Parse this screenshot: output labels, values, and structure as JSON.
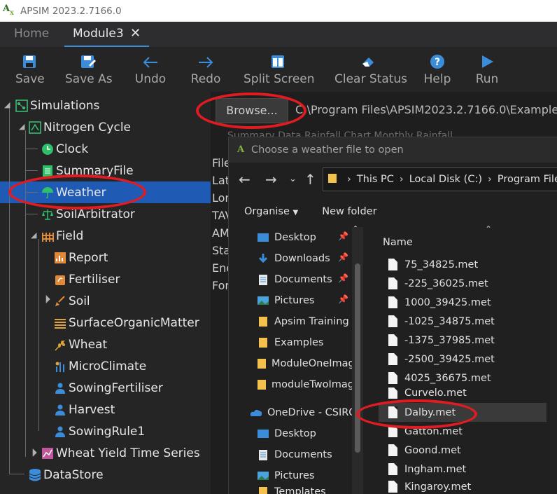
{
  "window": {
    "title": "APSIM 2023.2.7166.0",
    "logo_text": "Ax"
  },
  "tabs": [
    {
      "label": "Home"
    },
    {
      "label": "Module3",
      "close": "✕"
    }
  ],
  "toolbar": {
    "buttons": [
      {
        "label": "Save",
        "icon": "save-icon"
      },
      {
        "label": "Save As",
        "icon": "save-as-icon"
      },
      {
        "label": "Undo",
        "icon": "undo-icon"
      },
      {
        "label": "Redo",
        "icon": "redo-icon"
      },
      {
        "label": "Split Screen",
        "icon": "split-screen-icon"
      },
      {
        "label": "Clear Status",
        "icon": "eraser-icon"
      },
      {
        "label": "Help",
        "icon": "help-icon"
      },
      {
        "label": "Run",
        "icon": "run-icon"
      }
    ]
  },
  "tree": {
    "nodes": [
      {
        "label": "Simulations",
        "icon": "simulations-icon"
      },
      {
        "label": "Nitrogen Cycle",
        "icon": "simulation-icon"
      },
      {
        "label": "Clock",
        "icon": "clock-icon"
      },
      {
        "label": "SummaryFile",
        "icon": "summary-icon"
      },
      {
        "label": "Weather",
        "icon": "weather-icon",
        "selected": true
      },
      {
        "label": "SoilArbitrator",
        "icon": "scales-icon"
      },
      {
        "label": "Field",
        "icon": "field-fence-icon"
      },
      {
        "label": "Report",
        "icon": "report-icon"
      },
      {
        "label": "Fertiliser",
        "icon": "fertiliser-icon"
      },
      {
        "label": "Soil",
        "icon": "shovel-icon"
      },
      {
        "label": "SurfaceOrganicMatter",
        "icon": "surface-om-icon"
      },
      {
        "label": "Wheat",
        "icon": "wheat-icon"
      },
      {
        "label": "MicroClimate",
        "icon": "microclimate-icon"
      },
      {
        "label": "SowingFertiliser",
        "icon": "manager-icon"
      },
      {
        "label": "Harvest",
        "icon": "manager-icon"
      },
      {
        "label": "SowingRule1",
        "icon": "manager-icon"
      },
      {
        "label": "Wheat Yield Time Series",
        "icon": "graph-icon"
      },
      {
        "label": "DataStore",
        "icon": "database-icon"
      }
    ]
  },
  "weather_panel": {
    "browse_label": "Browse...",
    "file_path": "C:\\Program Files\\APSIM2023.2.7166.0\\Example",
    "background_tabs": "Summary   Data   Rainfall Chart   Monthly Rainfall",
    "labels": [
      "File",
      "Lat",
      "Lon",
      "TAV",
      "AMP",
      "Sta",
      "End",
      "",
      "For"
    ]
  },
  "dialog": {
    "title": "Choose a weather file to open",
    "address": [
      "This PC",
      "Local Disk (C:)",
      "Program Files"
    ],
    "organise_label": "Organise",
    "new_folder_label": "New folder",
    "nav_items": [
      {
        "label": "Desktop",
        "icon": "desktop-icon",
        "pinned": true
      },
      {
        "label": "Downloads",
        "icon": "downloads-icon",
        "pinned": true
      },
      {
        "label": "Documents",
        "icon": "documents-icon",
        "pinned": true
      },
      {
        "label": "Pictures",
        "icon": "pictures-icon",
        "pinned": true
      },
      {
        "label": "Apsim Training",
        "icon": "folder-icon"
      },
      {
        "label": "Examples",
        "icon": "folder-icon"
      },
      {
        "label": "ModuleOneImag",
        "icon": "folder-icon"
      },
      {
        "label": "moduleTwoImag",
        "icon": "folder-icon"
      },
      {
        "label": "OneDrive - CSIRO",
        "icon": "onedrive-icon"
      },
      {
        "label": "Desktop",
        "icon": "desktop-icon"
      },
      {
        "label": "Documents",
        "icon": "documents-icon"
      },
      {
        "label": "Pictures",
        "icon": "pictures-icon"
      },
      {
        "label": "Templates",
        "icon": "folder-icon"
      }
    ],
    "column_header": "Name",
    "files": [
      "75_34825.met",
      "-225_36025.met",
      "1000_39425.met",
      "-1025_34875.met",
      "-1375_37985.met",
      "-2500_39425.met",
      "4025_36675.met",
      "Curvelo.met",
      "Dalby.met",
      "Gatton.met",
      "Goond.met",
      "Ingham.met",
      "Kingaroy.met"
    ],
    "highlighted_file": "Dalby.met"
  },
  "colors": {
    "annotation_red": "#e01c23",
    "selection_blue": "#1f5bb5",
    "accent_blue": "#3b8cd9"
  }
}
